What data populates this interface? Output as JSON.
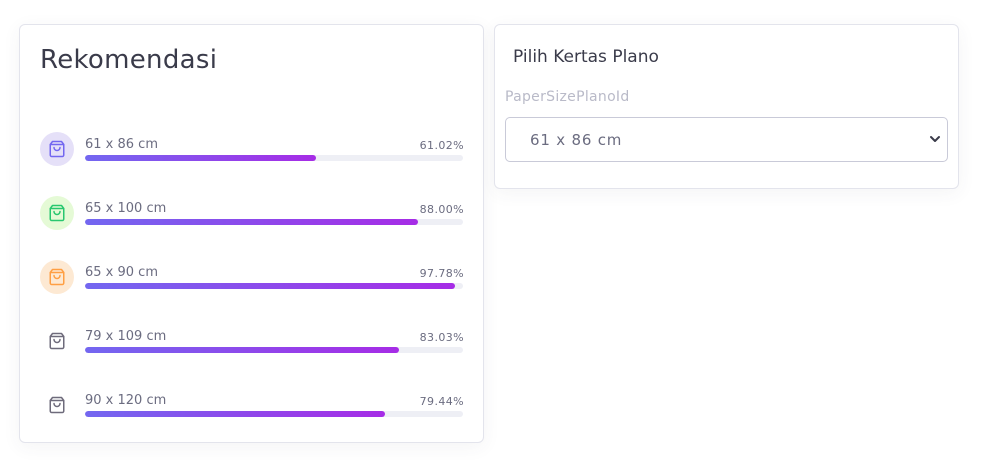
{
  "recommendations": {
    "title": "Rekomendasi",
    "items": [
      {
        "label": "61 x 86 cm",
        "percent_text": "61.02%",
        "fraction": 0.6102,
        "icon": "shopping-bag-icon",
        "icon_color": "#7367f0",
        "icon_bg": "#e5e0f8"
      },
      {
        "label": "65 x 100 cm",
        "percent_text": "88.00%",
        "fraction": 0.88,
        "icon": "shopping-bag-icon",
        "icon_color": "#28c76f",
        "icon_bg": "#e5fad6"
      },
      {
        "label": "65 x 90 cm",
        "percent_text": "97.78%",
        "fraction": 0.9778,
        "icon": "shopping-bag-icon",
        "icon_color": "#ff9f43",
        "icon_bg": "#fde9d3"
      },
      {
        "label": "79 x 109 cm",
        "percent_text": "83.03%",
        "fraction": 0.8303,
        "icon": "shopping-bag-icon",
        "icon_color": "#6e6b7b",
        "icon_bg": "#ffffff"
      },
      {
        "label": "90 x 120 cm",
        "percent_text": "79.44%",
        "fraction": 0.7944,
        "icon": "shopping-bag-icon",
        "icon_color": "#6e6b7b",
        "icon_bg": "#ffffff"
      }
    ]
  },
  "plano": {
    "title": "Pilih Kertas Plano",
    "field_label": "PaperSizePlanoId",
    "selected_value": "61 x 86 cm",
    "caret_icon": "chevron-down-icon"
  },
  "colors": {
    "accent_start": "#7367f0",
    "accent_end": "#a62ce6"
  }
}
